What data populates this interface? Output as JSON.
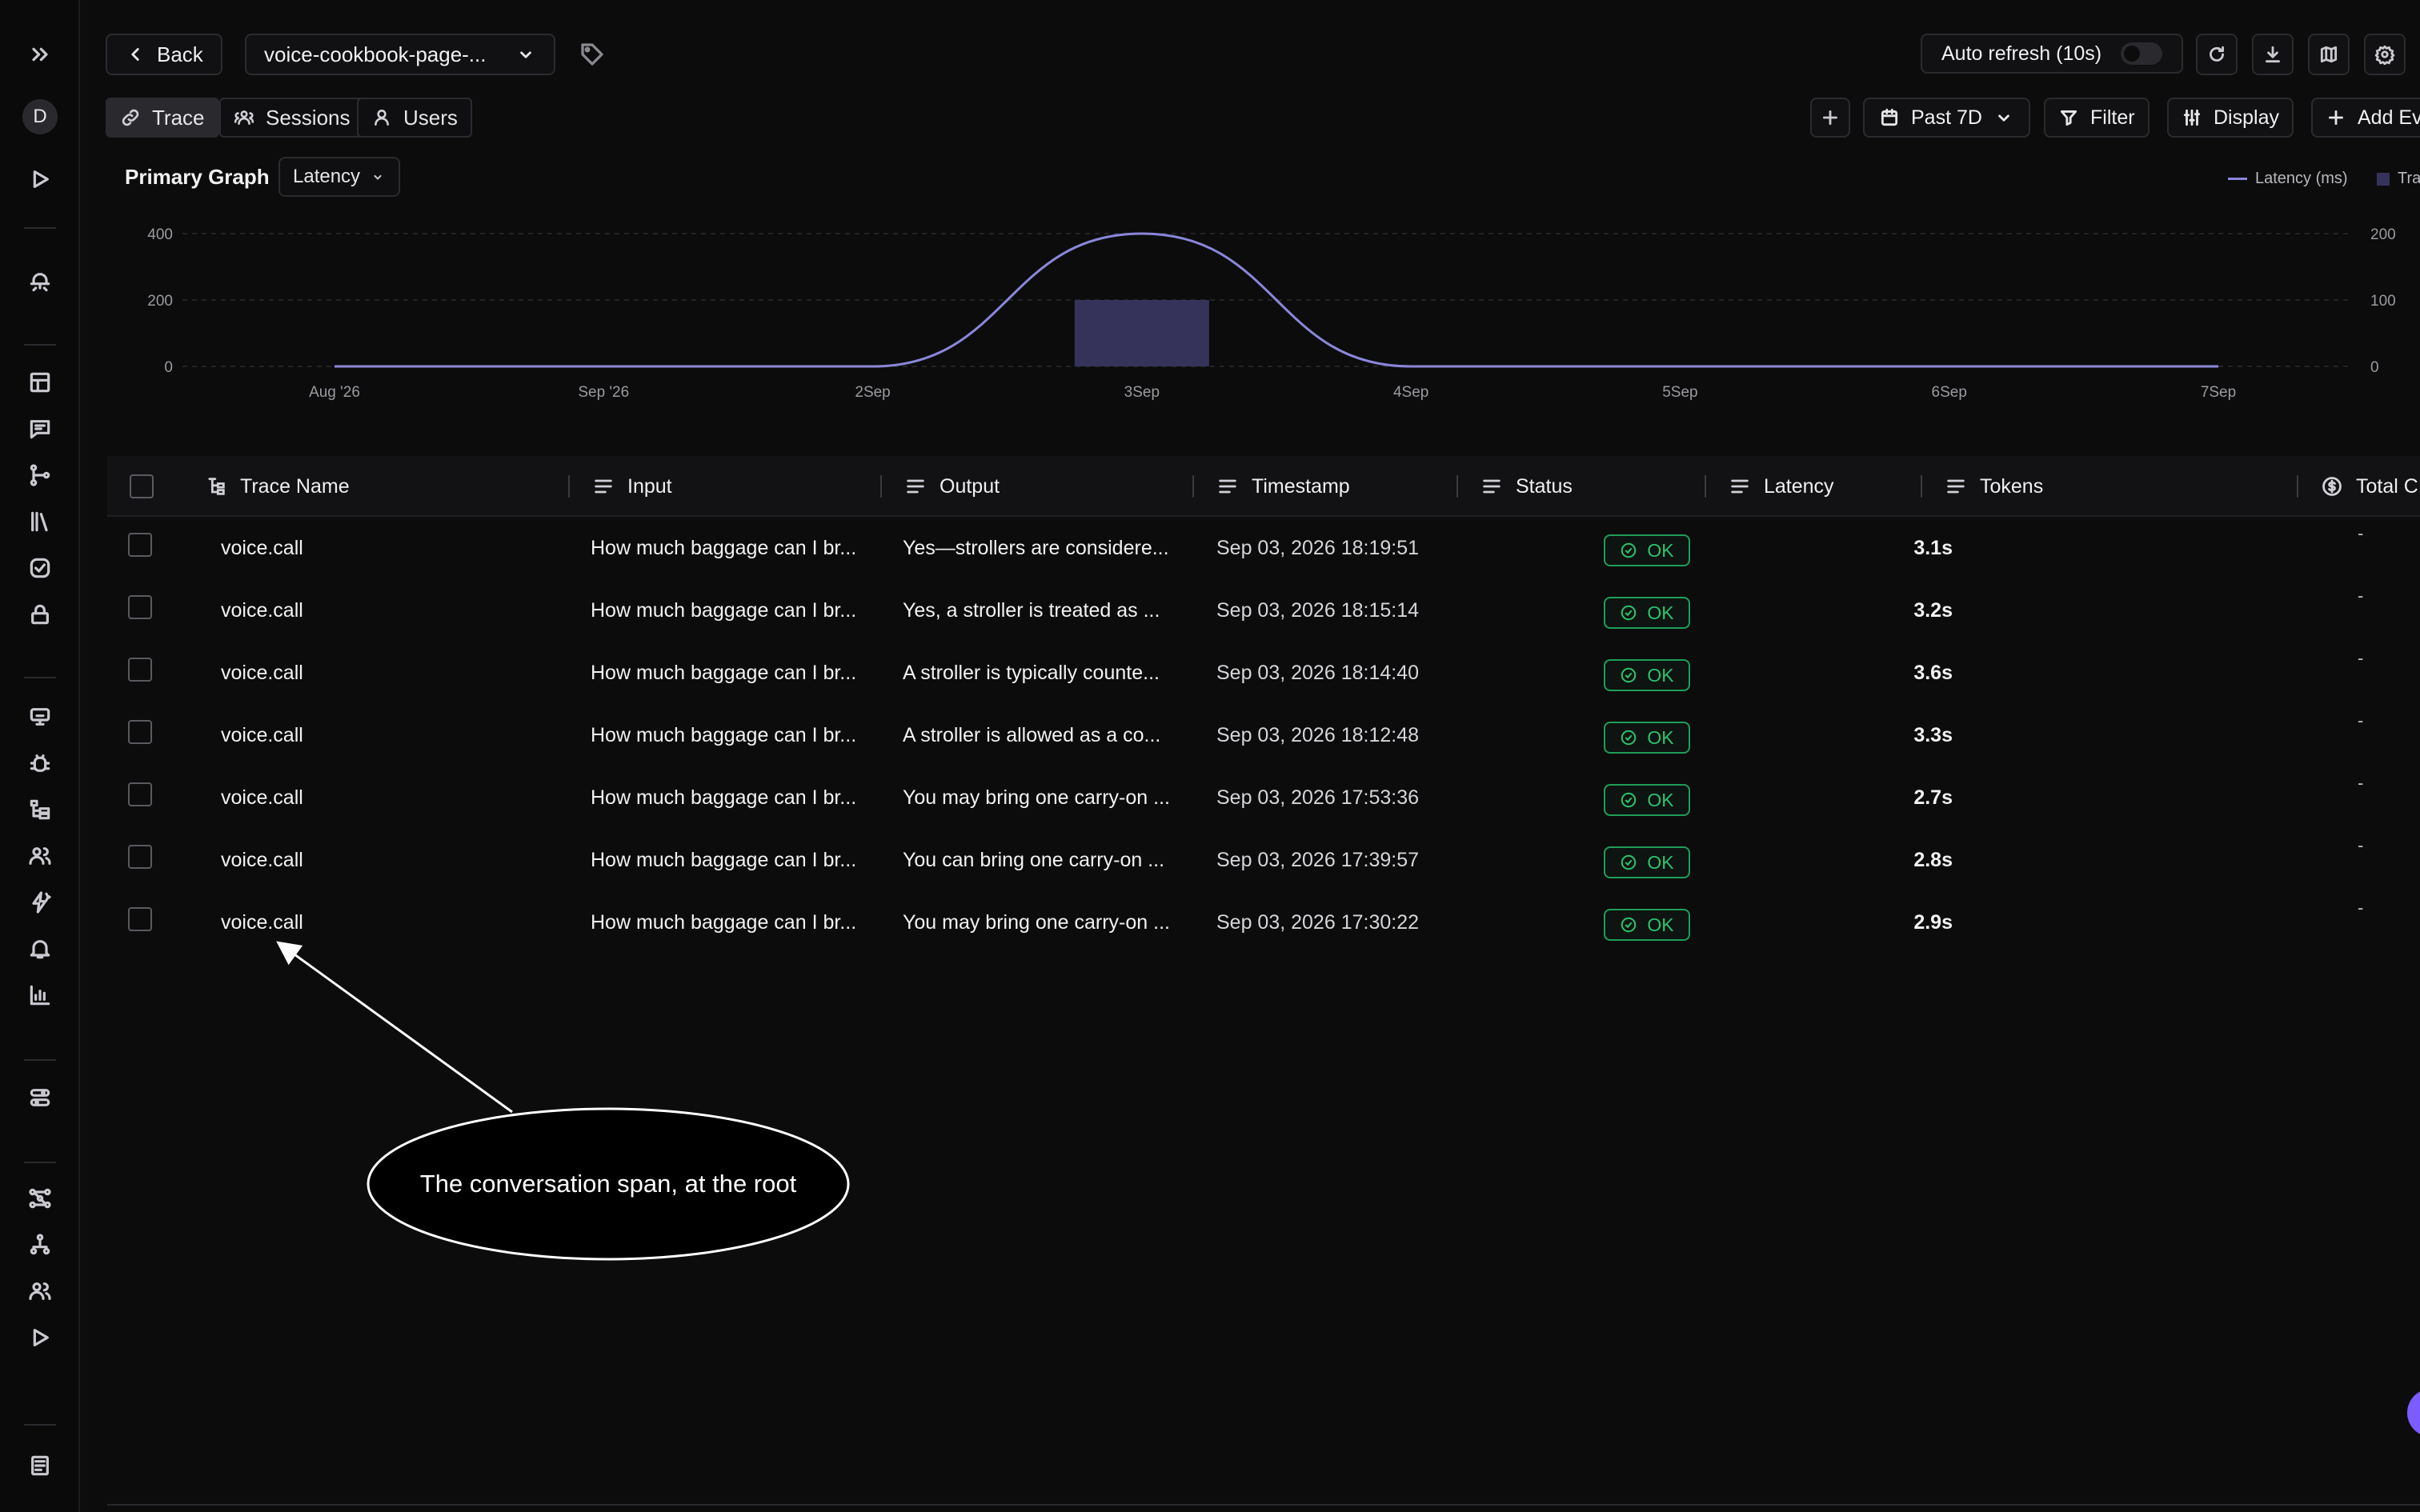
{
  "toolbar": {
    "back_label": "Back",
    "project_select": "voice-cookbook-page-...",
    "auto_refresh_label": "Auto refresh (10s)",
    "time_range": "Past 7D",
    "filter_label": "Filter",
    "display_label": "Display",
    "add_label": "Add Ev"
  },
  "tabs": [
    {
      "label": "Trace",
      "icon": "link-icon",
      "active": true
    },
    {
      "label": "Sessions",
      "icon": "users-icon",
      "active": false
    },
    {
      "label": "Users",
      "icon": "user-icon",
      "active": false
    }
  ],
  "sidebar": {
    "avatar_letter": "D",
    "icons": [
      "expand-icon",
      "play-icon",
      "bug-icon",
      "table-icon",
      "chat-icon",
      "flow-icon",
      "library-icon",
      "check-circle-icon",
      "lock-icon",
      "monitor-icon",
      "debug-icon",
      "tree-icon",
      "users-icon",
      "sparkle-icon",
      "bell-icon",
      "bar-chart-icon",
      "sliders-icon",
      "graph-icon",
      "network-icon",
      "team-icon",
      "run-icon",
      "docs-icon"
    ]
  },
  "graph": {
    "title": "Primary Graph",
    "metric_select": "Latency",
    "legend_latency": "Latency (ms)",
    "legend_traces": "Tra"
  },
  "chart_data": {
    "type": "line",
    "x": [
      "Aug '26",
      "Sep '26",
      "2Sep",
      "3Sep",
      "4Sep",
      "5Sep",
      "6Sep",
      "7Sep"
    ],
    "series": [
      {
        "name": "Latency (ms)",
        "values": [
          0,
          0,
          0,
          400,
          0,
          0,
          0,
          0
        ],
        "color": "#8b87d9"
      },
      {
        "name": "Tra",
        "type": "bar",
        "values": [
          0,
          0,
          0,
          100,
          0,
          0,
          0,
          0
        ],
        "color": "#35335a"
      }
    ],
    "y_left_ticks": [
      "400",
      "200",
      "0"
    ],
    "y_right_ticks": [
      "200",
      "100",
      "0"
    ],
    "ylim_left": [
      0,
      400
    ],
    "ylim_right": [
      0,
      200
    ],
    "grid": true
  },
  "table": {
    "columns": [
      "Trace Name",
      "Input",
      "Output",
      "Timestamp",
      "Status",
      "Latency",
      "Tokens",
      "Total C"
    ],
    "rows": [
      {
        "name": "voice.call",
        "input": "How much baggage can I br...",
        "output": "Yes—strollers are considere...",
        "timestamp": "Sep 03, 2026 18:19:51",
        "status": "OK",
        "latency": "3.1s",
        "cost": "-"
      },
      {
        "name": "voice.call",
        "input": "How much baggage can I br...",
        "output": "Yes, a stroller is treated as ...",
        "timestamp": "Sep 03, 2026 18:15:14",
        "status": "OK",
        "latency": "3.2s",
        "cost": "-"
      },
      {
        "name": "voice.call",
        "input": "How much baggage can I br...",
        "output": "A stroller is typically counte...",
        "timestamp": "Sep 03, 2026 18:14:40",
        "status": "OK",
        "latency": "3.6s",
        "cost": "-"
      },
      {
        "name": "voice.call",
        "input": "How much baggage can I br...",
        "output": "A stroller is allowed as a co...",
        "timestamp": "Sep 03, 2026 18:12:48",
        "status": "OK",
        "latency": "3.3s",
        "cost": "-"
      },
      {
        "name": "voice.call",
        "input": "How much baggage can I br...",
        "output": "You may bring one carry-on ...",
        "timestamp": "Sep 03, 2026 17:53:36",
        "status": "OK",
        "latency": "2.7s",
        "cost": "-"
      },
      {
        "name": "voice.call",
        "input": "How much baggage can I br...",
        "output": "You can bring one carry-on ...",
        "timestamp": "Sep 03, 2026 17:39:57",
        "status": "OK",
        "latency": "2.8s",
        "cost": "-"
      },
      {
        "name": "voice.call",
        "input": "How much baggage can I br...",
        "output": "You may bring one carry-on ...",
        "timestamp": "Sep 03, 2026 17:30:22",
        "status": "OK",
        "latency": "2.9s",
        "cost": "-"
      }
    ]
  },
  "annotation": {
    "label": "The conversation span, at the root"
  }
}
